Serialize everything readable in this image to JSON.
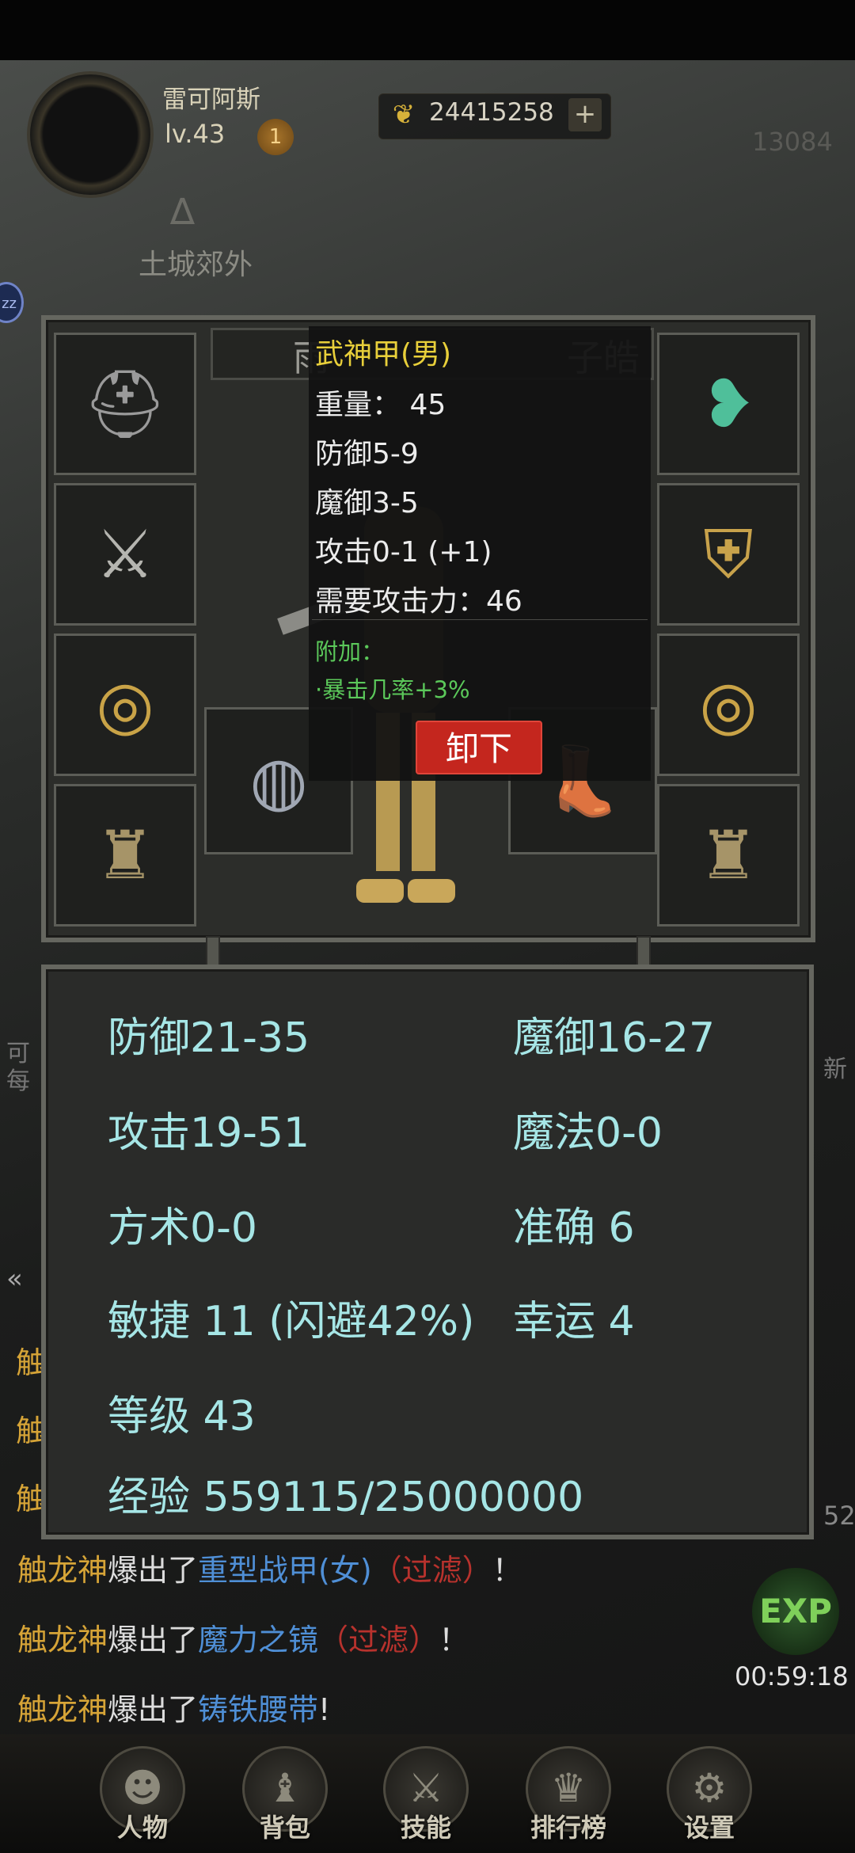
{
  "header": {
    "player_name": "雷可阿斯",
    "player_level": "lv.43",
    "level_badge": "1",
    "gold_amount": "24415258",
    "gold_plus": "+",
    "power_value": "13084",
    "location_name": "土城郊外",
    "side_bubble": "zz"
  },
  "equipment": {
    "character_name": "雨",
    "character_name_tail": "子皓",
    "slots_left": [
      {
        "name": "helmet",
        "icon": "helmet-icon"
      },
      {
        "name": "weapon",
        "icon": "sword-icon"
      },
      {
        "name": "ring-left",
        "icon": "ring-icon"
      },
      {
        "name": "ring-left-2",
        "icon": "spiked-ring-icon"
      }
    ],
    "slots_right": [
      {
        "name": "necklace",
        "icon": "necklace-icon"
      },
      {
        "name": "armor",
        "icon": "armor-icon"
      },
      {
        "name": "ring-right",
        "icon": "ring-icon"
      },
      {
        "name": "ring-right-2",
        "icon": "spiked-ring-icon"
      }
    ],
    "slots_bottom": [
      {
        "name": "belt",
        "icon": "belt-icon"
      },
      {
        "name": "boots",
        "icon": "boots-icon"
      }
    ]
  },
  "tooltip": {
    "title": "武神甲(男)",
    "lines": [
      "重量：  45",
      "防御5-9",
      "魔御3-5",
      "攻击0-1 (+1)",
      "需要攻击力：46"
    ],
    "extra_label": "附加：",
    "extra_value": "·暴击几率+3%",
    "unequip_label": "卸下"
  },
  "stats": {
    "defense": "防御21-35",
    "magic_defense": "魔御16-27",
    "attack": "攻击19-51",
    "magic": "魔法0-0",
    "taoism": "方术0-0",
    "accuracy": "准确 6",
    "agility": "敏捷 11 (闪避42%)",
    "luck": "幸运 4",
    "level": "等级 43",
    "experience": "经验 559115/25000000"
  },
  "edge_labels": {
    "left_1": "可",
    "left_2": "每",
    "right_1": "新",
    "left_chat_1": "触",
    "left_chat_2": "触",
    "left_chat_3": "触",
    "arrows": "«",
    "side_number": "52"
  },
  "chat": [
    {
      "actor": "触龙神",
      "verb": "爆出了",
      "item": "重型战甲(女)",
      "filter": "（过滤）",
      "end": "！"
    },
    {
      "actor": "触龙神",
      "verb": "爆出了",
      "item": "魔力之镜",
      "filter": "（过滤）",
      "end": "！"
    },
    {
      "actor": "触龙神",
      "verb": "爆出了",
      "item": "铸铁腰带",
      "filter": "",
      "end": "!"
    }
  ],
  "exp_badge": "EXP",
  "timer": "00:59:18",
  "bottom_nav": [
    {
      "label": "人物",
      "icon": "character-icon"
    },
    {
      "label": "背包",
      "icon": "bag-icon"
    },
    {
      "label": "技能",
      "icon": "skill-icon"
    },
    {
      "label": "排行榜",
      "icon": "ranking-icon"
    },
    {
      "label": "设置",
      "icon": "settings-icon"
    }
  ],
  "colors": {
    "stat_text": "#a6e6e6",
    "tooltip_title": "#e8cf3a",
    "tooltip_extra": "#5bc85a",
    "unequip_button": "#c4261e",
    "chat_actor": "#d6a437",
    "chat_item": "#4f8fd6",
    "chat_filter": "#b8322d"
  }
}
